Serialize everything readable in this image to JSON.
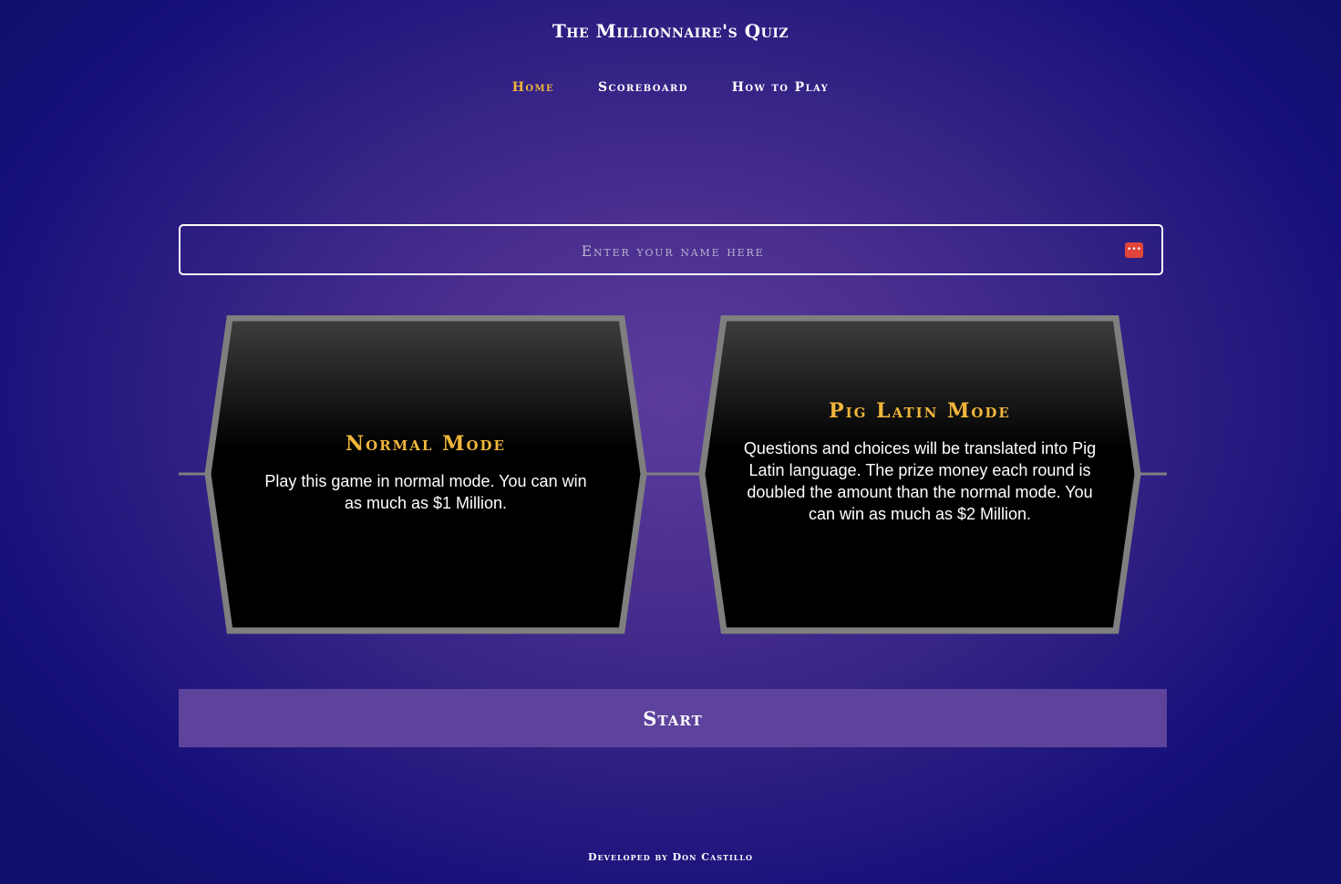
{
  "app": {
    "title": "The Millionnaire's Quiz"
  },
  "nav": {
    "items": [
      {
        "label": "Home",
        "active": true
      },
      {
        "label": "Scoreboard",
        "active": false
      },
      {
        "label": "How to Play",
        "active": false
      }
    ]
  },
  "name_input": {
    "placeholder": "Enter your name here",
    "value": "",
    "icon": "password-manager-icon"
  },
  "modes": [
    {
      "title": "Normal Mode",
      "description": "Play this game in normal mode. You can win as much as $1 Million."
    },
    {
      "title": "Pig Latin Mode",
      "description": "Questions and choices will be translated into Pig Latin language. The prize money each round is doubled the amount than the normal mode. You can win as much as $2 Million."
    }
  ],
  "start_button": {
    "label": "Start"
  },
  "footer": {
    "text": "Developed by Don Castillo"
  },
  "colors": {
    "accent": "#f0b63c",
    "background": "#16107a",
    "button": "#5d439b",
    "card_border": "#7f7f7f"
  }
}
